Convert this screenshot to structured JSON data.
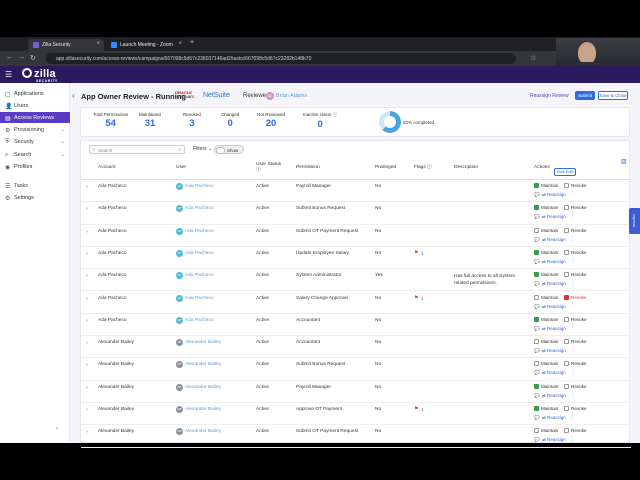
{
  "browser": {
    "tabs": [
      {
        "title": "Zilla Security",
        "color": "#7b5ce0"
      },
      {
        "title": "Launch Meeting - Zoom",
        "color": "#2d8cff"
      }
    ],
    "url": "app.zillasecurity.com/access-reviews/campaigns/667098c5d67c236037146ad2/tasks/667098c5d67c23282b148b70"
  },
  "webcam": {
    "caption": "Adam St. Onge | Zilla Security"
  },
  "app": {
    "logo_text": "zilla",
    "logo_sub": "SECURITY"
  },
  "sidebar": {
    "items": [
      {
        "label": "Applications",
        "icon": "▢",
        "active": false,
        "chevron": ""
      },
      {
        "label": "Users",
        "icon": "👤",
        "active": false,
        "chevron": ""
      },
      {
        "label": "Access Reviews",
        "icon": "▤",
        "active": true,
        "chevron": ""
      },
      {
        "label": "Provisioning",
        "icon": "⚙",
        "active": false,
        "chevron": "⌄"
      },
      {
        "label": "Security",
        "icon": "⛨",
        "active": false,
        "chevron": "⌄"
      },
      {
        "label": "Search",
        "icon": "⌕",
        "active": false,
        "chevron": "⌄"
      },
      {
        "label": "Profiles",
        "icon": "◉",
        "active": false,
        "chevron": ""
      },
      {
        "label": "Tasks",
        "icon": "☰",
        "active": false,
        "chevron": ""
      },
      {
        "label": "Settings",
        "icon": "⚙",
        "active": false,
        "chevron": ""
      }
    ]
  },
  "header": {
    "title": "App Owner Review - Running -",
    "oracle": "ORACLE",
    "oracle_sub": "NETSUITE",
    "app_name": "NetSuite",
    "reviewer_label": "Reviewer:",
    "reviewer_initials": "BA",
    "reviewer_name": "Brian Adams",
    "reassign_label": "Reassign Review",
    "submit_label": "Submit",
    "save_label": "Save & Close"
  },
  "stats": {
    "items": [
      {
        "label": "Total Permissions",
        "value": "54"
      },
      {
        "label": "Maintained",
        "value": "31"
      },
      {
        "label": "Revoked",
        "value": "3"
      },
      {
        "label": "Changed",
        "value": "0"
      },
      {
        "label": "Not Reviewed",
        "value": "20"
      },
      {
        "label": "Inactive Users ⓘ",
        "value": "0"
      }
    ],
    "percent_completed": 62,
    "percent_label": "62% completed"
  },
  "table": {
    "search_placeholder": "Search",
    "filters_label": "Filters",
    "toggle_label": "Show",
    "bulk_label": "Bulk Edit",
    "columns": {
      "account": "Account",
      "user": "User",
      "user_status": "User Status ⓘ",
      "permission": "Permission",
      "privileged": "Privileged",
      "flags": "Flags ⓘ",
      "description": "Description",
      "actions": "Actions"
    },
    "maintain_label": "Maintain",
    "revoke_label": "Revoke",
    "reassign_label": "⇄ Reassign",
    "comment_icon": "💬",
    "rows": [
      {
        "account": "Ada Pacheco",
        "initials": "AP",
        "user": "Ada Pacheco",
        "status": "Active",
        "permission": "Payroll Manager",
        "privileged": "No",
        "flag": "",
        "description": "",
        "decision": "maintain"
      },
      {
        "account": "Ada Pacheco",
        "initials": "AP",
        "user": "Ada Pacheco",
        "status": "Active",
        "permission": "Submit Bonus Request",
        "privileged": "No",
        "flag": "",
        "description": "",
        "decision": "maintain"
      },
      {
        "account": "Ada Pacheco",
        "initials": "AP",
        "user": "Ada Pacheco",
        "status": "Active",
        "permission": "Submit OT Payment Request",
        "privileged": "No",
        "flag": "",
        "description": "",
        "decision": "none"
      },
      {
        "account": "Ada Pacheco",
        "initials": "AP",
        "user": "Ada Pacheco",
        "status": "Active",
        "permission": "Update Employee Salary",
        "privileged": "No",
        "flag": "1",
        "description": "",
        "decision": "maintain"
      },
      {
        "account": "Ada Pacheco",
        "initials": "AP",
        "user": "Ada Pacheco",
        "status": "Active",
        "permission": "System Administrator",
        "privileged": "Yes",
        "flag": "",
        "description": "Has full access to all System related permissions.",
        "decision": "maintain"
      },
      {
        "account": "Ada Pacheco",
        "initials": "AP",
        "user": "Ada Pacheco",
        "status": "Active",
        "permission": "Salary Change Approval",
        "privileged": "No",
        "flag": "1",
        "description": "",
        "decision": "revoke"
      },
      {
        "account": "Ada Pacheco",
        "initials": "AP",
        "user": "Ada Pacheco",
        "status": "Active",
        "permission": "Accountant",
        "privileged": "No",
        "flag": "",
        "description": "",
        "decision": "maintain"
      },
      {
        "account": "Alexander Bailey",
        "initials": "AB",
        "user": "Alexander Bailey",
        "status": "Active",
        "permission": "Accountant",
        "privileged": "No",
        "flag": "",
        "description": "",
        "decision": "none"
      },
      {
        "account": "Alexander Bailey",
        "initials": "AB",
        "user": "Alexander Bailey",
        "status": "Active",
        "permission": "Submit Bonus Request",
        "privileged": "No",
        "flag": "",
        "description": "",
        "decision": "none"
      },
      {
        "account": "Alexander Bailey",
        "initials": "AB",
        "user": "Alexander Bailey",
        "status": "Active",
        "permission": "Payroll Manager",
        "privileged": "No",
        "flag": "",
        "description": "",
        "decision": "maintain"
      },
      {
        "account": "Alexander Bailey",
        "initials": "AB",
        "user": "Alexander Bailey",
        "status": "Active",
        "permission": "Approve OT Payment",
        "privileged": "No",
        "flag": "1",
        "description": "",
        "decision": "maintain"
      },
      {
        "account": "Alexander Bailey",
        "initials": "AB",
        "user": "Alexander Bailey",
        "status": "Active",
        "permission": "Submit OT Payment Request",
        "privileged": "No",
        "flag": "",
        "description": "",
        "decision": "none"
      }
    ]
  },
  "side_tab": {
    "label": "coprsm"
  },
  "colors": {
    "brand": "#2b1a5e",
    "accent": "#5b3cc4",
    "link": "#2d6be0",
    "maintain": "#2e9e4a",
    "revoke": "#d33333"
  }
}
